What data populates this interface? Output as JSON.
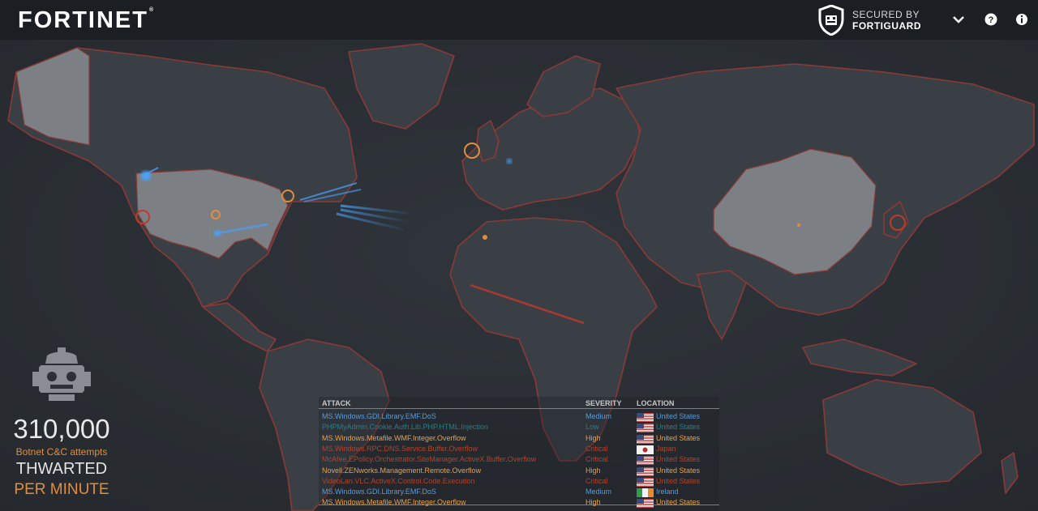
{
  "header": {
    "brand": "FORTINET",
    "brand_mark": "®",
    "secured_line1": "SECURED BY",
    "secured_line2": "FORTIGUARD",
    "icons": [
      "shield-icon",
      "chevron-down-icon",
      "help-icon",
      "info-icon"
    ]
  },
  "stats": {
    "count": "310,000",
    "label": "Botnet C&C attempts",
    "thwarted": "THWARTED",
    "per_minute": "PER MINUTE",
    "accent": "#e08e3c"
  },
  "feed": {
    "headers": {
      "attack": "ATTACK",
      "severity": "SEVERITY",
      "location": "LOCATION"
    },
    "rows": [
      {
        "attack": "MS.Windows.GDI.Library.EMF.DoS",
        "severity": "Medium",
        "location": "United States",
        "color": "#5b9bd5",
        "flag": "us"
      },
      {
        "attack": "PHPMyAdmin.Cookie.Auth.Lib.PHP.HTML.Injection",
        "severity": "Low",
        "location": "United States",
        "color": "#2f7d86",
        "flag": "us"
      },
      {
        "attack": "MS.Windows.Metafile.WMF.Integer.Overflow",
        "severity": "High",
        "location": "United States",
        "color": "#e6a24a",
        "flag": "us"
      },
      {
        "attack": "MS.Windows.RPC.DNS.Service.Buffer.Overflow",
        "severity": "Critical",
        "location": "Japan",
        "color": "#b0442c",
        "flag": "jp"
      },
      {
        "attack": "McAfee.EPolicy.Orchestrator.SiteManager.ActiveX.Buffer.Overflow",
        "severity": "Critical",
        "location": "United States",
        "color": "#b0442c",
        "flag": "us"
      },
      {
        "attack": "Novell.ZENworks.Management.Remote.Overflow",
        "severity": "High",
        "location": "United States",
        "color": "#e6a24a",
        "flag": "us"
      },
      {
        "attack": "VideoLan.VLC.ActiveX.Control.Code.Execution",
        "severity": "Critical",
        "location": "United States",
        "color": "#b0442c",
        "flag": "us"
      },
      {
        "attack": "MS.Windows.GDI.Library.EMF.DoS",
        "severity": "Medium",
        "location": "Ireland",
        "color": "#5b9bd5",
        "flag": "ie"
      },
      {
        "attack": "MS.Windows.Metafile.WMF.Integer.Overflow",
        "severity": "High",
        "location": "United States",
        "color": "#e6a24a",
        "flag": "us"
      }
    ]
  },
  "colors": {
    "background": "#2b3036",
    "land": "#3a3f46",
    "highlight_land": "#7c7f83",
    "border_glow": "#8a3a36",
    "topbar": "#1b1e22"
  }
}
